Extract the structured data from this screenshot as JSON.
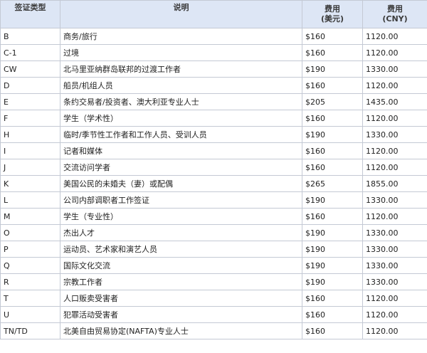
{
  "table": {
    "headers": {
      "type": "签证类型",
      "desc": "说明",
      "usd_line1": "费用",
      "usd_line2": "(美元)",
      "cny_line1": "费用",
      "cny_line2": "(CNY)"
    },
    "rows": [
      {
        "type": "B",
        "desc": "商务/旅行",
        "usd": "$160",
        "cny": "1120.00"
      },
      {
        "type": "C-1",
        "desc": "过境",
        "usd": "$160",
        "cny": "1120.00"
      },
      {
        "type": "CW",
        "desc": "北马里亚纳群岛联邦的过渡工作者",
        "usd": "$190",
        "cny": "1330.00"
      },
      {
        "type": "D",
        "desc": "船员/机组人员",
        "usd": "$160",
        "cny": "1120.00"
      },
      {
        "type": "E",
        "desc": "条约交易者/投资者、澳大利亚专业人士",
        "usd": "$205",
        "cny": "1435.00"
      },
      {
        "type": "F",
        "desc": "学生（学术性）",
        "usd": "$160",
        "cny": "1120.00"
      },
      {
        "type": "H",
        "desc": "临时/季节性工作者和工作人员、受训人员",
        "usd": "$190",
        "cny": "1330.00"
      },
      {
        "type": "I",
        "desc": "记者和媒体",
        "usd": "$160",
        "cny": "1120.00"
      },
      {
        "type": "J",
        "desc": "交流访问学者",
        "usd": "$160",
        "cny": "1120.00"
      },
      {
        "type": "K",
        "desc": "美国公民的未婚夫（妻）或配偶",
        "usd": "$265",
        "cny": "1855.00"
      },
      {
        "type": "L",
        "desc": "公司内部调职者工作签证",
        "usd": "$190",
        "cny": "1330.00"
      },
      {
        "type": "M",
        "desc": "学生（专业性）",
        "usd": "$160",
        "cny": "1120.00"
      },
      {
        "type": "O",
        "desc": "杰出人才",
        "usd": "$190",
        "cny": "1330.00"
      },
      {
        "type": "P",
        "desc": "运动员、艺术家和演艺人员",
        "usd": "$190",
        "cny": "1330.00"
      },
      {
        "type": "Q",
        "desc": "国际文化交流",
        "usd": "$190",
        "cny": "1330.00"
      },
      {
        "type": "R",
        "desc": "宗教工作者",
        "usd": "$190",
        "cny": "1330.00"
      },
      {
        "type": "T",
        "desc": "人口贩卖受害者",
        "usd": "$160",
        "cny": "1120.00"
      },
      {
        "type": "U",
        "desc": "犯罪活动受害者",
        "usd": "$160",
        "cny": "1120.00"
      },
      {
        "type": "TN/TD",
        "desc": "北美自由贸易协定(NAFTA)专业人士",
        "usd": "$160",
        "cny": "1120.00"
      }
    ]
  }
}
